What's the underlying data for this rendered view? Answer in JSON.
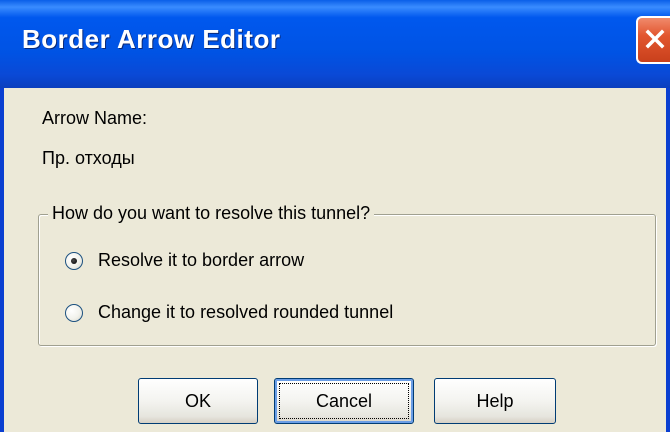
{
  "window": {
    "title": "Border Arrow Editor",
    "close_icon": "close-icon"
  },
  "arrow_name": {
    "label": "Arrow Name:",
    "value": "Пр. отходы"
  },
  "resolve_group": {
    "legend": "How do you want to resolve this tunnel?",
    "options": [
      {
        "label": "Resolve it to border arrow",
        "selected": true
      },
      {
        "label": "Change it to resolved rounded tunnel",
        "selected": false
      }
    ]
  },
  "buttons": {
    "ok": "OK",
    "cancel": "Cancel",
    "help": "Help"
  },
  "colors": {
    "titlebar": "#0054e3",
    "dialog_bg": "#ece9d8",
    "close_button": "#e2562f"
  }
}
